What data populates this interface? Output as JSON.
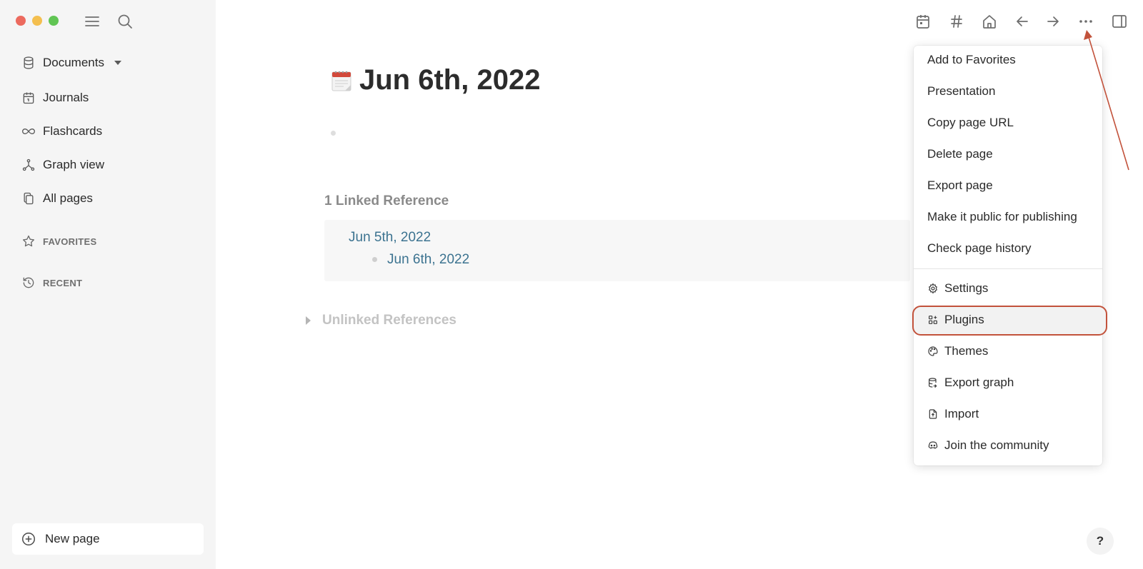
{
  "sidebar": {
    "graph_name": "Documents",
    "nav": [
      "Journals",
      "Flashcards",
      "Graph view",
      "All pages"
    ],
    "favorites_label": "FAVORITES",
    "recent_label": "RECENT",
    "new_page_label": "New page"
  },
  "toolbar": {
    "icons": [
      "calendar-icon",
      "hash-icon",
      "home-icon",
      "back-arrow-icon",
      "forward-arrow-icon",
      "more-icon",
      "sidebar-toggle-icon"
    ]
  },
  "page": {
    "title": "Jun 6th, 2022",
    "linked_references_title": "1 Linked Reference",
    "reference_page": "Jun 5th, 2022",
    "reference_block": "Jun 6th, 2022",
    "unlinked_references_title": "Unlinked References"
  },
  "menu": {
    "items": [
      "Add to Favorites",
      "Presentation",
      "Copy page URL",
      "Delete page",
      "Export page",
      "Make it public for publishing",
      "Check page history"
    ],
    "secondary_items": [
      {
        "label": "Settings",
        "icon": "settings-icon"
      },
      {
        "label": "Plugins",
        "icon": "plugins-icon"
      },
      {
        "label": "Themes",
        "icon": "palette-icon"
      },
      {
        "label": "Export graph",
        "icon": "database-export-icon"
      },
      {
        "label": "Import",
        "icon": "file-import-icon"
      },
      {
        "label": "Join the community",
        "icon": "discord-icon"
      }
    ],
    "highlighted_item": "Plugins"
  },
  "help_label": "?",
  "colors": {
    "sidebar_bg": "#f5f5f5",
    "link": "#3c7390",
    "annotation": "#c2523b"
  }
}
